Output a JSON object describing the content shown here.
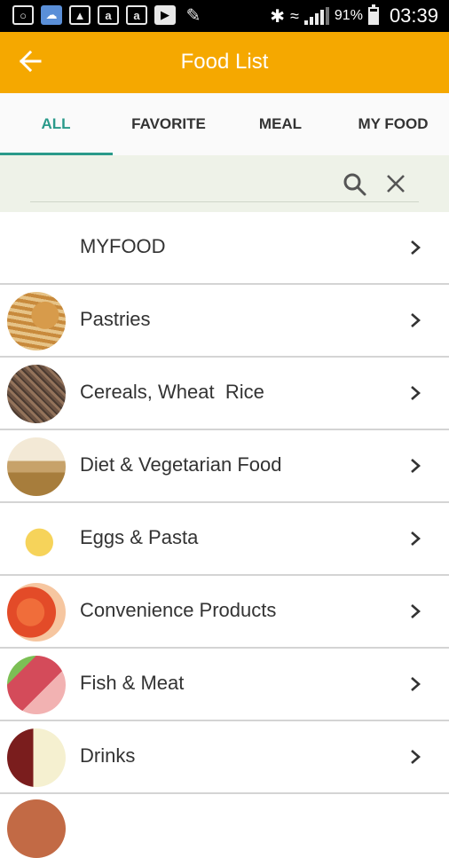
{
  "status_bar": {
    "battery_percent": "91%",
    "time": "03:39"
  },
  "app_bar": {
    "title": "Food List",
    "back_icon": "arrow-left-icon"
  },
  "tabs": [
    {
      "label": "ALL",
      "active": true
    },
    {
      "label": "FAVORITE",
      "active": false
    },
    {
      "label": "MEAL",
      "active": false
    },
    {
      "label": "MY FOOD",
      "active": false
    }
  ],
  "search": {
    "value": "",
    "search_icon": "search-icon",
    "clear_icon": "close-icon"
  },
  "categories": [
    {
      "label": "MYFOOD",
      "image": "none"
    },
    {
      "label": "Pastries",
      "image": "pastries"
    },
    {
      "label": "Cereals, Wheat  Rice",
      "image": "cereals"
    },
    {
      "label": "Diet & Vegetarian Food",
      "image": "diet"
    },
    {
      "label": "Eggs & Pasta",
      "image": "eggs"
    },
    {
      "label": "Convenience Products",
      "image": "conv"
    },
    {
      "label": "Fish & Meat",
      "image": "fish"
    },
    {
      "label": "Drinks",
      "image": "drinks"
    }
  ],
  "colors": {
    "app_bar": "#f5a800",
    "tab_active": "#2a9a8a",
    "search_bg": "#eef2e8"
  }
}
